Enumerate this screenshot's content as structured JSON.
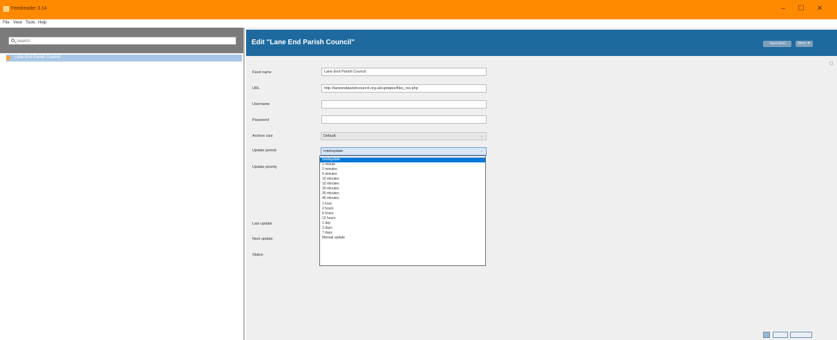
{
  "window": {
    "title": "Feedreader 3.14",
    "minimize_glyph": "–",
    "maximize_glyph": "☐",
    "close_glyph": "✕",
    "accent_color": "#ff8a00"
  },
  "menu": {
    "file": "File",
    "view": "View",
    "tools": "Tools",
    "help": "Help"
  },
  "sidebar": {
    "search_placeholder": "Search",
    "items": [
      {
        "label": "Lane End Parish Council",
        "selected": true
      }
    ]
  },
  "header": {
    "title": "Edit \"Lane End Parish Council\"",
    "save_button": "Save feed",
    "more_button": "More ▼",
    "color": "#1e6a9e"
  },
  "form": {
    "feed_name_label": "Feed name",
    "feed_name_value": "Lane End Parish Council",
    "url_label": "URL",
    "url_value": "http://laneendparishcouncil.org.uk/updates/files_rss.php",
    "username_label": "Username",
    "username_value": "",
    "password_label": "Password",
    "password_value": "",
    "archive_size_label": "Archive size",
    "archive_size_value": "Default",
    "update_period_label": "Update period",
    "update_period_value": "Intellupdate",
    "update_priority_label": "Update priority",
    "last_update_label": "Last update",
    "next_update_label": "Next update",
    "status_label": "Status"
  },
  "dropdown": {
    "options": [
      "Intellupdate",
      "1 minute",
      "2 minutes",
      "5 minutes",
      "10 minutes",
      "15 minutes",
      "20 minutes",
      "30 minutes",
      "45 minutes",
      "1 hour",
      "2 hours",
      "6 hours",
      "12 hours",
      "1 day",
      "2 days",
      "7 days",
      "Manual update"
    ],
    "selected_index": 0
  }
}
